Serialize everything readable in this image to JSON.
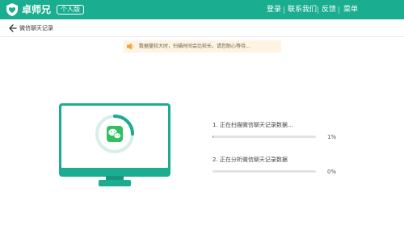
{
  "header": {
    "brand": "卓师兄",
    "edition": "个人版",
    "nav": [
      {
        "label": "登录"
      },
      {
        "label": "联系我们"
      },
      {
        "label": "反馈"
      },
      {
        "label": "菜单"
      }
    ]
  },
  "page": {
    "title": "微信聊天记录"
  },
  "notice": {
    "text": "数据量较大时，扫描时间会比较长，请您耐心等待..."
  },
  "steps": [
    {
      "label": "1. 正在扫描微信聊天记录数据...",
      "percent_label": "1%",
      "progress": 0.01
    },
    {
      "label": "2. 正在分析微信聊天记录数据",
      "percent_label": "0%",
      "progress": 0
    }
  ],
  "colors": {
    "brand": "#1aad8f",
    "wechat_green": "#2fc060",
    "notice_bg": "#fdf4e4"
  },
  "icons": {
    "logo": "shield-heart-logo",
    "back": "arrow-left-icon",
    "notice": "speaker-icon",
    "app": "wechat-icon"
  }
}
